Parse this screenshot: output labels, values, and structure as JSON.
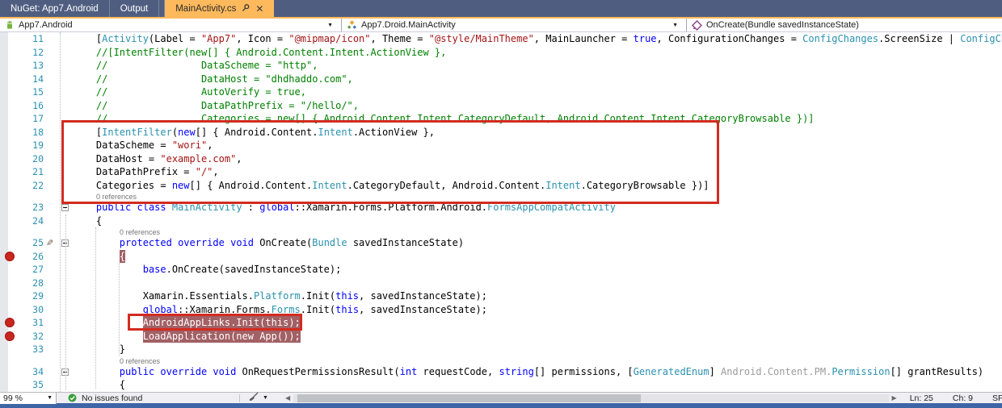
{
  "tabs": [
    {
      "label": "NuGet: App7.Android",
      "active": false
    },
    {
      "label": "Output",
      "active": false
    },
    {
      "label": "MainActivity.cs",
      "active": true
    }
  ],
  "navbar": {
    "project": "App7.Android",
    "type": "App7.Droid.MainActivity",
    "member": "OnCreate(Bundle savedInstanceState)"
  },
  "editor": {
    "codelens_label": "0 references",
    "rows": [
      {
        "num": "11",
        "segs": [
          [
            "n",
            "    ["
          ],
          [
            "t",
            "Activity"
          ],
          [
            "n",
            "(Label = "
          ],
          [
            "s",
            "\"App7\""
          ],
          [
            "n",
            ", Icon = "
          ],
          [
            "s",
            "\"@mipmap/icon\""
          ],
          [
            "n",
            ", Theme = "
          ],
          [
            "s",
            "\"@style/MainTheme\""
          ],
          [
            "n",
            ", MainLauncher = "
          ],
          [
            "k",
            "true"
          ],
          [
            "n",
            ", ConfigurationChanges = "
          ],
          [
            "t",
            "ConfigChanges"
          ],
          [
            "n",
            ".ScreenSize | "
          ],
          [
            "t",
            "ConfigChang"
          ]
        ]
      },
      {
        "num": "12",
        "segs": [
          [
            "c",
            "    //[IntentFilter(new[] { Android.Content.Intent.ActionView },"
          ]
        ]
      },
      {
        "num": "13",
        "segs": [
          [
            "c",
            "    //                DataScheme = \"http\","
          ]
        ]
      },
      {
        "num": "14",
        "segs": [
          [
            "c",
            "    //                DataHost = \"dhdhaddo.com\","
          ]
        ]
      },
      {
        "num": "15",
        "segs": [
          [
            "c",
            "    //                AutoVerify = true,"
          ]
        ]
      },
      {
        "num": "16",
        "segs": [
          [
            "c",
            "    //                DataPathPrefix = \"/hello/\","
          ]
        ]
      },
      {
        "num": "17",
        "segs": [
          [
            "c",
            "    //                Categories = new[] { Android.Content.Intent.CategoryDefault, Android.Content.Intent.CategoryBrowsable })]"
          ]
        ]
      },
      {
        "num": "18",
        "segs": [
          [
            "n",
            "    ["
          ],
          [
            "t",
            "IntentFilter"
          ],
          [
            "n",
            "("
          ],
          [
            "k",
            "new"
          ],
          [
            "n",
            "[] { Android.Content."
          ],
          [
            "t",
            "Intent"
          ],
          [
            "n",
            ".ActionView },"
          ]
        ]
      },
      {
        "num": "19",
        "segs": [
          [
            "n",
            "    DataScheme = "
          ],
          [
            "s",
            "\"wori\""
          ],
          [
            "n",
            ","
          ]
        ]
      },
      {
        "num": "20",
        "segs": [
          [
            "n",
            "    DataHost = "
          ],
          [
            "s",
            "\"example.com\""
          ],
          [
            "n",
            ","
          ]
        ]
      },
      {
        "num": "21",
        "segs": [
          [
            "n",
            "    DataPathPrefix = "
          ],
          [
            "s",
            "\"/\""
          ],
          [
            "n",
            ","
          ]
        ]
      },
      {
        "num": "22",
        "segs": [
          [
            "n",
            "    Categories = "
          ],
          [
            "k",
            "new"
          ],
          [
            "n",
            "[] { Android.Content."
          ],
          [
            "t",
            "Intent"
          ],
          [
            "n",
            ".CategoryDefault, Android.Content."
          ],
          [
            "t",
            "Intent"
          ],
          [
            "n",
            ".CategoryBrowsable })]"
          ]
        ]
      },
      {
        "lens": true,
        "pad": 29
      },
      {
        "num": "23",
        "collapse": true,
        "segs": [
          [
            "n",
            "    "
          ],
          [
            "k",
            "public"
          ],
          [
            "n",
            " "
          ],
          [
            "k",
            "class"
          ],
          [
            "n",
            " "
          ],
          [
            "t",
            "MainActivity"
          ],
          [
            "n",
            " : "
          ],
          [
            "k",
            "global"
          ],
          [
            "n",
            "::Xamarin.Forms.Platform.Android."
          ],
          [
            "t",
            "FormsAppCompatActivity"
          ]
        ]
      },
      {
        "num": "24",
        "segs": [
          [
            "n",
            "    {"
          ]
        ]
      },
      {
        "lens": true,
        "pad": 58
      },
      {
        "num": "25",
        "pencil": true,
        "collapse": true,
        "segs": [
          [
            "n",
            "        "
          ],
          [
            "k",
            "protected"
          ],
          [
            "n",
            " "
          ],
          [
            "k",
            "override"
          ],
          [
            "n",
            " "
          ],
          [
            "k",
            "void"
          ],
          [
            "n",
            " OnCreate("
          ],
          [
            "t",
            "Bundle"
          ],
          [
            "n",
            " savedInstanceState)"
          ]
        ]
      },
      {
        "num": "26",
        "bp": true,
        "segs": [
          [
            "n",
            "        "
          ],
          [
            "hlb",
            "{"
          ]
        ]
      },
      {
        "num": "27",
        "segs": [
          [
            "n",
            "            "
          ],
          [
            "k",
            "base"
          ],
          [
            "n",
            ".OnCreate(savedInstanceState);"
          ]
        ]
      },
      {
        "num": "28",
        "segs": []
      },
      {
        "num": "29",
        "segs": [
          [
            "n",
            "            Xamarin.Essentials."
          ],
          [
            "t",
            "Platform"
          ],
          [
            "n",
            ".Init("
          ],
          [
            "k",
            "this"
          ],
          [
            "n",
            ", savedInstanceState);"
          ]
        ]
      },
      {
        "num": "30",
        "segs": [
          [
            "n",
            "            "
          ],
          [
            "k",
            "global"
          ],
          [
            "n",
            "::Xamarin.Forms."
          ],
          [
            "t",
            "Forms"
          ],
          [
            "n",
            ".Init("
          ],
          [
            "k",
            "this"
          ],
          [
            "n",
            ", savedInstanceState);"
          ]
        ]
      },
      {
        "num": "31",
        "bp": true,
        "segs": [
          [
            "n",
            "            "
          ],
          [
            "hl",
            "AndroidAppLinks.Init(this);"
          ]
        ]
      },
      {
        "num": "32",
        "bp": true,
        "segs": [
          [
            "n",
            "            "
          ],
          [
            "hl",
            "LoadApplication(new App());"
          ]
        ]
      },
      {
        "num": "33",
        "segs": [
          [
            "n",
            "        }"
          ]
        ]
      },
      {
        "lens": true,
        "pad": 58
      },
      {
        "num": "34",
        "collapse": true,
        "segs": [
          [
            "n",
            "        "
          ],
          [
            "k",
            "public"
          ],
          [
            "n",
            " "
          ],
          [
            "k",
            "override"
          ],
          [
            "n",
            " "
          ],
          [
            "k",
            "void"
          ],
          [
            "n",
            " OnRequestPermissionsResult("
          ],
          [
            "k",
            "int"
          ],
          [
            "n",
            " requestCode, "
          ],
          [
            "k",
            "string"
          ],
          [
            "n",
            "[] permissions, ["
          ],
          [
            "t",
            "GeneratedEnum"
          ],
          [
            "n",
            "] "
          ],
          [
            "g",
            "Android.Content.PM."
          ],
          [
            "t",
            "Permission"
          ],
          [
            "n",
            "[] grantResults)"
          ]
        ]
      },
      {
        "num": "35",
        "segs": [
          [
            "n",
            "        {"
          ]
        ]
      }
    ]
  },
  "status": {
    "zoom_level": "99 %",
    "health": "No issues found",
    "line": "Ln: 25",
    "column": "Ch: 9",
    "mode": "SP"
  },
  "colors": {
    "active_tab_accent": "#FEB95C",
    "tab_strip": "#4F5E80",
    "keyword": "#0000FF",
    "type": "#2B91AF",
    "string": "#A31515",
    "comment": "#008000",
    "line_number": "#2B91AF",
    "breakpoint": "#C8271E",
    "breakpoint_highlight": "#A26165",
    "annotation_box": "#D22B20",
    "status_bar_blue": "#3E65A5"
  }
}
